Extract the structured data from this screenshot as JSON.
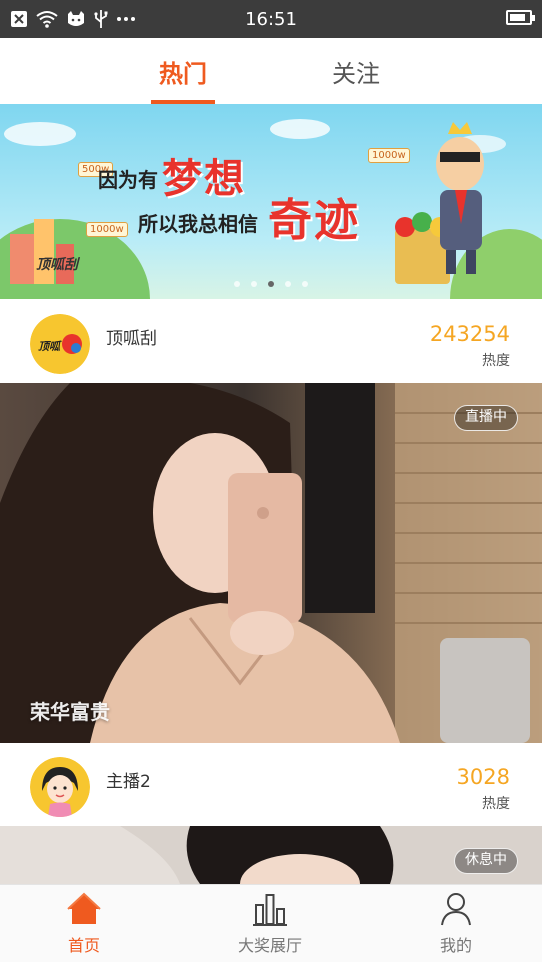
{
  "status_bar": {
    "time": "16:51",
    "battery_level": 0.85,
    "icons": [
      "close-box-icon",
      "wifi-icon",
      "cat-icon",
      "usb-icon",
      "more-dots-icon"
    ]
  },
  "top_tabs": [
    {
      "label": "热门",
      "active": true
    },
    {
      "label": "关注",
      "active": false
    }
  ],
  "banner": {
    "line1": "因为有",
    "dream": "梦想",
    "line2": "所以我总相信",
    "miracle": "奇迹",
    "tag_500w": "500w",
    "tag_1000w_left": "1000w",
    "tag_1000w_right": "1000w",
    "brand": "顶呱刮",
    "slide_count": 5,
    "active_slide": 2
  },
  "streamers": [
    {
      "name": "顶呱刮",
      "heat_value": "243254",
      "heat_label": "热度",
      "avatar": "dingguagua-logo-icon"
    },
    {
      "name": "主播2",
      "heat_value": "3028",
      "heat_label": "热度",
      "avatar": "cartoon-girl-avatar-icon"
    }
  ],
  "live_cards": [
    {
      "status": "直播中",
      "room_title": "荣华富贵"
    },
    {
      "status": "休息中",
      "room_title": ""
    }
  ],
  "bottom_nav": [
    {
      "label": "首页",
      "icon": "home-icon",
      "active": true
    },
    {
      "label": "大奖展厅",
      "icon": "bar-chart-icon",
      "active": false
    },
    {
      "label": "我的",
      "icon": "person-icon",
      "active": false
    }
  ],
  "colors": {
    "accent": "#ef5a1f",
    "heat": "#f5a623",
    "status_bar": "#3c3c3c"
  }
}
